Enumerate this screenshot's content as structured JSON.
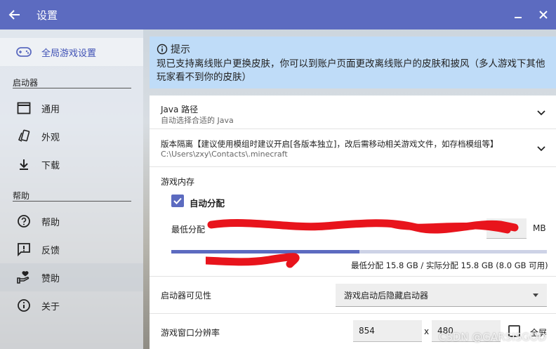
{
  "window": {
    "title": "设置"
  },
  "sidebar": {
    "global_settings": "全局游戏设置",
    "section_launcher": "启动器",
    "items_launcher": [
      {
        "label": "通用",
        "icon": "window-icon"
      },
      {
        "label": "外观",
        "icon": "cards-icon"
      },
      {
        "label": "下载",
        "icon": "download-icon"
      }
    ],
    "section_help": "帮助",
    "items_help": [
      {
        "label": "帮助",
        "icon": "help-circle-icon"
      },
      {
        "label": "反馈",
        "icon": "feedback-icon"
      },
      {
        "label": "赞助",
        "icon": "heart-hand-icon"
      },
      {
        "label": "关于",
        "icon": "info-icon"
      }
    ]
  },
  "tip": {
    "title": "提示",
    "text": "现已支持离线账户更换皮肤，你可以到账户页面更改离线账户的皮肤和披风（多人游戏下其他玩家看不到你的皮肤）"
  },
  "settings": {
    "java": {
      "title": "Java 路径",
      "subtitle": "自动选择合适的 Java"
    },
    "isolation": {
      "title": "版本隔离【建议使用模组时建议开启[各版本独立]，改后需移动相关游戏文件，如存档模组等】",
      "subtitle": "C:\\Users\\zxy\\Contacts\\.minecraft"
    },
    "memory": {
      "title": "游戏内存",
      "auto_label": "自动分配",
      "auto_checked": true,
      "min_label": "最低分配",
      "unit": "MB",
      "usage_fraction": 0.5,
      "summary": "最低分配 15.8 GB / 实际分配 15.8 GB (8.0 GB 可用)"
    },
    "visibility": {
      "label": "启动器可见性",
      "value": "游戏启动后隐藏启动器"
    },
    "resolution": {
      "label": "游戏窗口分辨率",
      "width": "854",
      "sep": "x",
      "height": "480",
      "fullscreen_label": "全屏"
    }
  },
  "watermark": "CSDN @GARSISGOD",
  "colors": {
    "accent": "#5c6bc0",
    "tip_bg": "#bfdcf8",
    "redaction": "#e8141c"
  }
}
